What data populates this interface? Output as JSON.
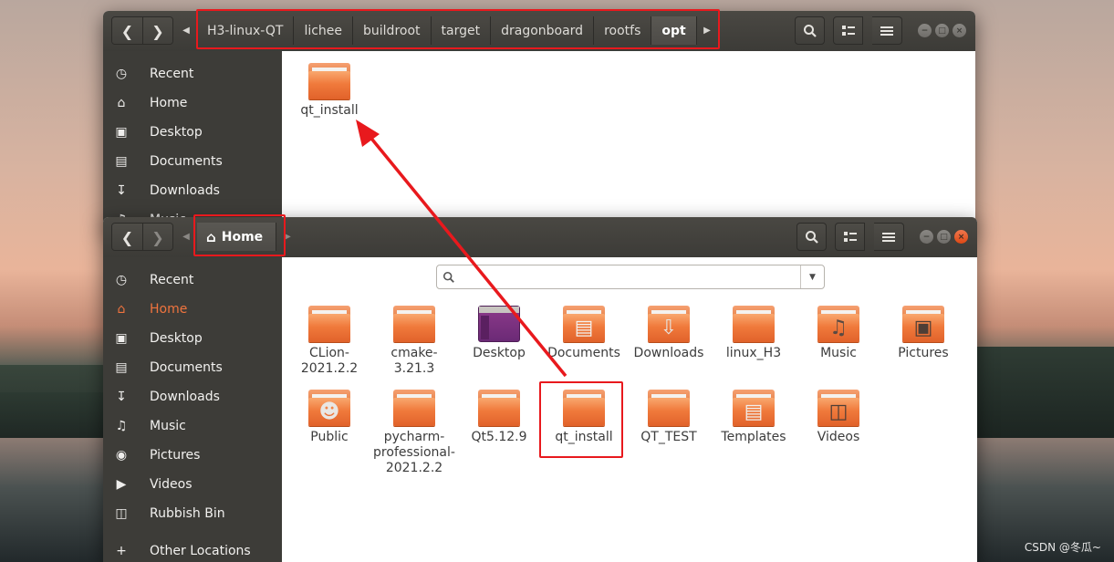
{
  "back_window": {
    "breadcrumbs": [
      "H3-linux-QT",
      "lichee",
      "buildroot",
      "target",
      "dragonboard",
      "rootfs",
      "opt"
    ],
    "sidebar": [
      {
        "label": "Recent",
        "icon": "clock-icon"
      },
      {
        "label": "Home",
        "icon": "home-icon"
      },
      {
        "label": "Desktop",
        "icon": "folder-icon"
      },
      {
        "label": "Documents",
        "icon": "document-icon"
      },
      {
        "label": "Downloads",
        "icon": "download-icon"
      },
      {
        "label": "Music",
        "icon": "music-icon"
      }
    ],
    "files": [
      {
        "label": "qt_install"
      }
    ]
  },
  "front_window": {
    "location": "Home",
    "search_placeholder": "",
    "sidebar": [
      {
        "label": "Recent",
        "icon": "clock-icon"
      },
      {
        "label": "Home",
        "icon": "home-icon"
      },
      {
        "label": "Desktop",
        "icon": "folder-icon"
      },
      {
        "label": "Documents",
        "icon": "document-icon"
      },
      {
        "label": "Downloads",
        "icon": "download-icon"
      },
      {
        "label": "Music",
        "icon": "music-icon"
      },
      {
        "label": "Pictures",
        "icon": "camera-icon"
      },
      {
        "label": "Videos",
        "icon": "video-icon"
      },
      {
        "label": "Rubbish Bin",
        "icon": "trash-icon"
      },
      {
        "label": "Other Locations",
        "icon": "plus-icon"
      }
    ],
    "files": [
      {
        "label": "CLion-2021.2.2"
      },
      {
        "label": "cmake-3.21.3"
      },
      {
        "label": "Desktop"
      },
      {
        "label": "Documents"
      },
      {
        "label": "Downloads"
      },
      {
        "label": "linux_H3"
      },
      {
        "label": "Music"
      },
      {
        "label": "Pictures"
      },
      {
        "label": "Public"
      },
      {
        "label": "pycharm-professional-2021.2.2"
      },
      {
        "label": "Qt5.12.9"
      },
      {
        "label": "qt_install"
      },
      {
        "label": "QT_TEST"
      },
      {
        "label": "Templates"
      },
      {
        "label": "Videos"
      }
    ]
  },
  "watermark": "CSDN @冬瓜~",
  "colors": {
    "accent": "#f0743e",
    "annotation": "#e8191d",
    "headerbar": "#3c3b37",
    "sidebar": "#3d3c38"
  }
}
